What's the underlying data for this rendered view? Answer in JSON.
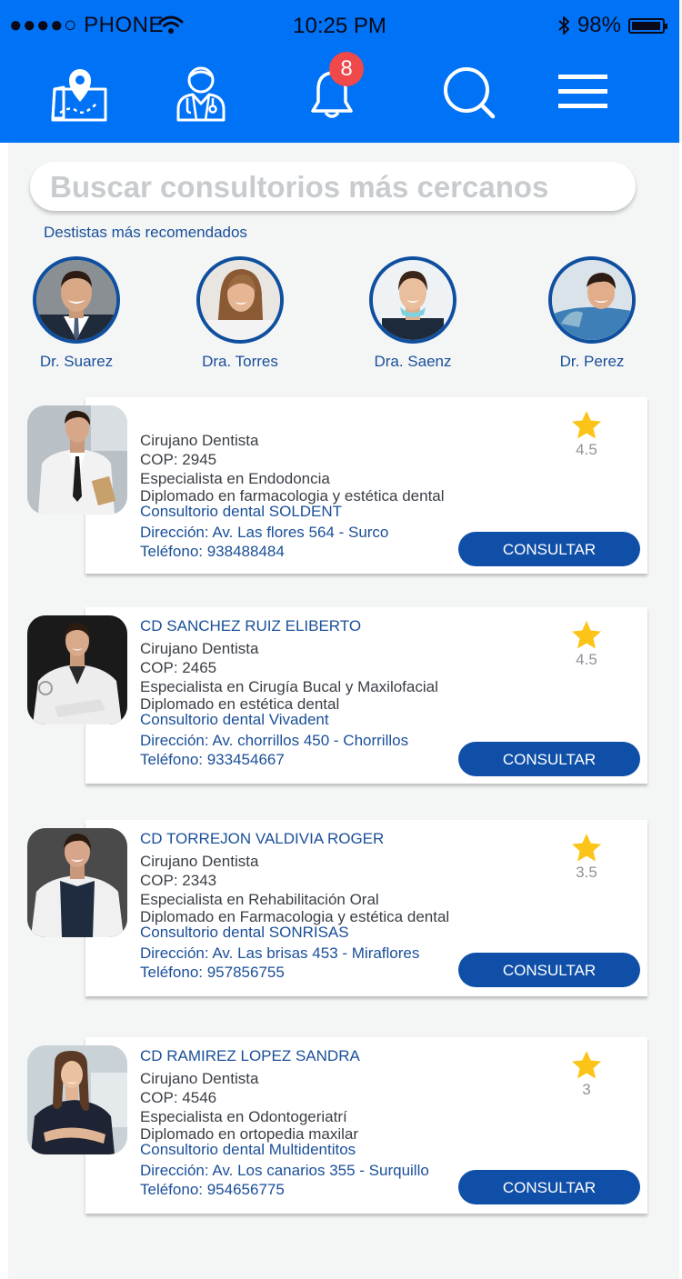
{
  "status_bar": {
    "carrier": "●●●●○ PHONE",
    "time": "10:25 PM",
    "battery": "98%",
    "battery_level": 0.98
  },
  "nav": {
    "notification_count": "8",
    "icons": [
      "map-pin-icon",
      "doctor-icon",
      "bell-icon",
      "search-icon",
      "menu-icon"
    ]
  },
  "search": {
    "placeholder": "Buscar consultorios más cercanos"
  },
  "recommended": {
    "label": "Destistas más recomendados",
    "doctors": [
      {
        "name": "Dr. Suarez"
      },
      {
        "name": "Dra. Torres"
      },
      {
        "name": "Dra. Saenz"
      },
      {
        "name": "Dr. Perez"
      }
    ]
  },
  "cards": [
    {
      "name": "",
      "title": "Cirujano Dentista",
      "cop": "COP: 2945",
      "specialty": "Especialista en Endodoncia",
      "diploma": "Diplomado en farmacologia y estética dental",
      "clinic": "Consultorio dental SOLDENT",
      "address": "Dirección: Av. Las flores 564 - Surco",
      "phone": "Teléfono: 938488484",
      "rating": "4.5",
      "button": "CONSULTAR"
    },
    {
      "name": "CD SANCHEZ RUIZ  ELIBERTO",
      "title": "Cirujano Dentista",
      "cop": "COP: 2465",
      "specialty": "Especialista en Cirugía Bucal y Maxilofacial",
      "diploma": "Diplomado en estética dental",
      "clinic": "Consultorio dental Vivadent",
      "address": "Dirección: Av. chorrillos 450 - Chorrillos",
      "phone": "Teléfono: 933454667",
      "rating": "4.5",
      "button": "CONSULTAR"
    },
    {
      "name": "CD TORREJON VALDIVIA ROGER",
      "title": "Cirujano Dentista",
      "cop": "COP: 2343",
      "specialty": "Especialista en Rehabilitación Oral",
      "diploma": "Diplomado en Farmacologia y estética dental",
      "clinic": "Consultorio dental SONRISAS",
      "address": "Dirección: Av. Las brisas 453 - Miraflores",
      "phone": "Teléfono: 957856755",
      "rating": "3.5",
      "button": "CONSULTAR"
    },
    {
      "name": "CD RAMIREZ LOPEZ SANDRA",
      "title": "Cirujano Dentista",
      "cop": "COP: 4546",
      "specialty": "Especialista en Odontogeriatrí",
      "diploma": "Diplomado en ortopedia maxilar",
      "clinic": "Consultorio dental Multidentitos",
      "address": "Dirección: Av. Los canarios 355 - Surquillo",
      "phone": "Teléfono: 954656775",
      "rating": "3",
      "button": "CONSULTAR"
    }
  ],
  "colors": {
    "header": "#0072f5",
    "accent": "#1a4f99",
    "button": "#0f4fa8",
    "badge": "#f0494a",
    "star": "#fcc419"
  }
}
